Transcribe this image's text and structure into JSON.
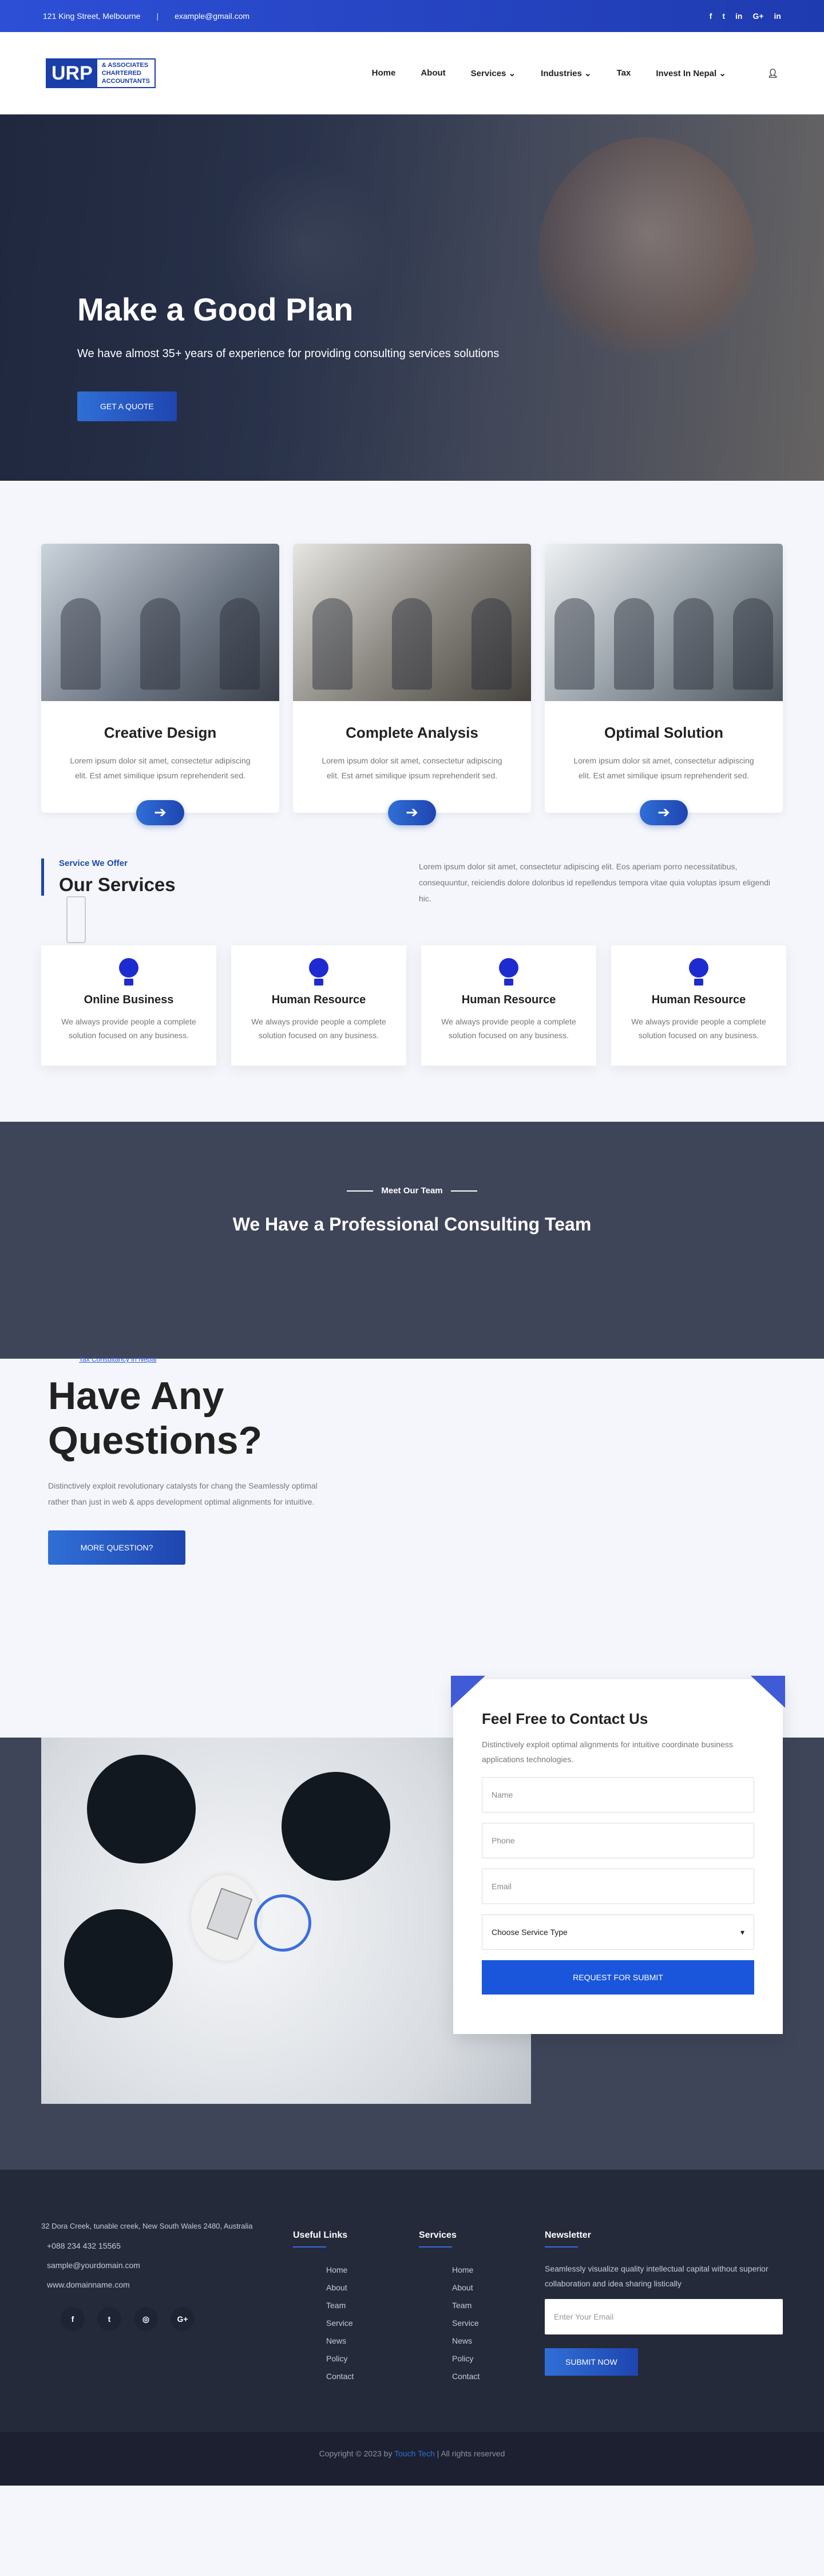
{
  "topbar": {
    "address": "121 King Street, Melbourne",
    "separator": "|",
    "email": "example@gmail.com",
    "social": [
      "f",
      "t",
      "in",
      "G+",
      "in"
    ]
  },
  "brand": {
    "logo_main": "URP",
    "logo_lines": [
      "& ASSOCIATES",
      "CHARTERED",
      "ACCOUNTANTS"
    ]
  },
  "nav": {
    "items": [
      {
        "label": "Home",
        "caret": false
      },
      {
        "label": "About",
        "caret": false
      },
      {
        "label": "Services",
        "caret": true
      },
      {
        "label": "Industries",
        "caret": true
      },
      {
        "label": "Tax",
        "caret": false
      },
      {
        "label": "Invest In Nepal",
        "caret": true
      }
    ],
    "user_icon": "user-icon"
  },
  "hero": {
    "title": "Make a Good Plan",
    "subtitle": "We have almost 35+ years of experience for providing consulting services solutions",
    "cta": "GET A QUOTE"
  },
  "features": [
    {
      "title": "Creative Design",
      "text": "Lorem ipsum dolor sit amet, consectetur adipiscing elit. Est amet similique ipsum reprehenderit sed."
    },
    {
      "title": "Complete Analysis",
      "text": "Lorem ipsum dolor sit amet, consectetur adipiscing elit. Est amet similique ipsum reprehenderit sed."
    },
    {
      "title": "Optimal Solution",
      "text": "Lorem ipsum dolor sit amet, consectetur adipiscing elit. Est amet similique ipsum reprehenderit sed."
    }
  ],
  "services": {
    "kicker": "Service We Offer",
    "title": "Our Services",
    "description": "Lorem ipsum dolor sit amet, consectetur adipiscing elit. Eos aperiam porro necessitatibus, consequuntur, reiciendis dolore doloribus id repellendus tempora vitae quia voluptas ipsum eligendi hic.",
    "items": [
      {
        "title": "Online Business",
        "text": "We always provide people a complete solution focused on any business."
      },
      {
        "title": "Human Resource",
        "text": "We always provide people a complete solution focused on any business."
      },
      {
        "title": "Human Resource",
        "text": "We always provide people a complete solution focused on any business."
      },
      {
        "title": "Human Resource",
        "text": "We always provide people a complete solution focused on any business."
      }
    ]
  },
  "team": {
    "kicker": "Meet Our Team",
    "title": "We Have a Professional Consulting Team"
  },
  "questions": {
    "link": "Tax Consultancy in Nepal",
    "title_line1": "Have Any",
    "title_line2": "Questions?",
    "text": "Distinctively exploit revolutionary catalysts for chang the Seamlessly optimal rather than just in web & apps development optimal alignments for intuitive.",
    "cta": "MORE QUESTION?"
  },
  "contact": {
    "title": "Feel Free to Contact Us",
    "text": "Distinctively exploit optimal alignments for intuitive coordinate business applications technologies.",
    "name_placeholder": "Name",
    "phone_placeholder": "Phone",
    "email_placeholder": "Email",
    "service_select": "Choose Service Type",
    "submit": "REQUEST FOR SUBMIT"
  },
  "footer": {
    "address": "32 Dora Creek, tunable creek, New South Wales 2480, Australia",
    "phone": "+088 234 432 15565",
    "email": "sample@yourdomain.com",
    "website": "www.domainname.com",
    "social": [
      "f",
      "t",
      "◎",
      "G+"
    ],
    "useful_links_title": "Useful Links",
    "useful_links": [
      "Home",
      "About",
      "Team",
      "Service",
      "News",
      "Policy",
      "Contact"
    ],
    "services_title": "Services",
    "services_links": [
      "Home",
      "About",
      "Team",
      "Service",
      "News",
      "Policy",
      "Contact"
    ],
    "newsletter_title": "Newsletter",
    "newsletter_text": "Seamlessly visualize quality intellectual capital without superior collaboration and idea sharing listically",
    "newsletter_placeholder": "Enter Your Email",
    "newsletter_button": "SUBMIT NOW"
  },
  "copyright": {
    "prefix": "Copyright © 2023 by",
    "brand": "Touch Tech",
    "suffix": "| All rights reserved"
  }
}
